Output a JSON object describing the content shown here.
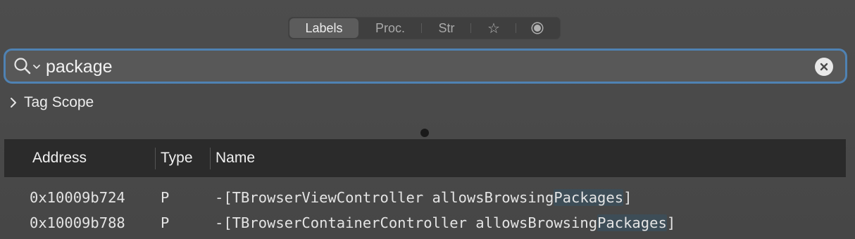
{
  "tabs": [
    {
      "label": "Labels",
      "selected": true
    },
    {
      "label": "Proc.",
      "selected": false
    },
    {
      "label": "Str",
      "selected": false
    },
    {
      "icon": "star-icon",
      "glyph": "☆",
      "selected": false
    },
    {
      "icon": "dot-circle-icon",
      "selected": false
    }
  ],
  "search": {
    "value": "package",
    "focus_color": "#4f82b3"
  },
  "tag_scope": {
    "label": "Tag Scope",
    "expanded": false
  },
  "table": {
    "columns": [
      "Address",
      "Type",
      "Name"
    ],
    "rows": [
      {
        "address": "0x10009b724",
        "type": "P",
        "name_prefix": "-[TBrowserViewController allowsBrowsing",
        "name_match": "Packages",
        "name_suffix": "]"
      },
      {
        "address": "0x10009b788",
        "type": "P",
        "name_prefix": "-[TBrowserContainerController allowsBrowsing",
        "name_match": "Packages",
        "name_suffix": "]"
      }
    ]
  },
  "colors": {
    "background": "#4a4a4a",
    "header_background": "#2b2b2b",
    "match_highlight": "#3d4d57"
  }
}
